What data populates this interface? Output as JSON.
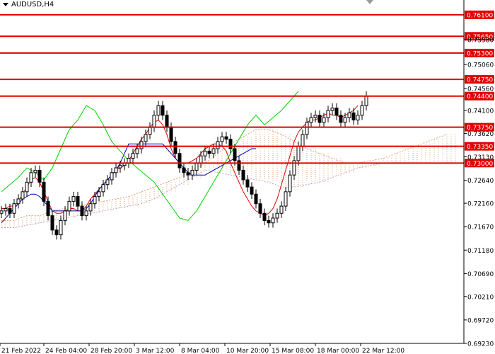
{
  "symbol": {
    "label": "AUDUSD,H4"
  },
  "chart_data": {
    "type": "candlestick",
    "symbol": "AUDUSD",
    "timeframe": "H4",
    "ylim": [
      0.6923,
      0.7635
    ],
    "x_tick_labels": [
      "21 Feb 2022",
      "24 Feb 04:00",
      "28 Feb 20:00",
      "3 Mar 12:00",
      "8 Mar 04:00",
      "10 Mar 20:00",
      "15 Mar 08:00",
      "18 Mar 00:00",
      "22 Mar 12:00"
    ],
    "y_tick_labels": [
      "0.75580",
      "0.75060",
      "0.74560",
      "0.74100",
      "0.73620",
      "0.73130",
      "0.72640",
      "0.72160",
      "0.71670",
      "0.71180",
      "0.70690",
      "0.70210",
      "0.69720",
      "0.69230"
    ],
    "y_tick_values": [
      0.7558,
      0.7506,
      0.7456,
      0.741,
      0.7362,
      0.7313,
      0.7264,
      0.7216,
      0.7167,
      0.7118,
      0.7069,
      0.7021,
      0.6972,
      0.6923
    ],
    "levels": [
      {
        "label": "0.76100",
        "value": 0.761
      },
      {
        "label": "0.75650",
        "value": 0.7565
      },
      {
        "label": "0.75300",
        "value": 0.753
      },
      {
        "label": "0.74750",
        "value": 0.7475
      },
      {
        "label": "0.74400",
        "value": 0.744
      },
      {
        "label": "0.73750",
        "value": 0.7375
      },
      {
        "label": "0.73350",
        "value": 0.7335
      },
      {
        "label": "0.73000",
        "value": 0.73
      }
    ],
    "close": [
      0.72,
      0.7205,
      0.7195,
      0.7215,
      0.7225,
      0.724,
      0.726,
      0.728,
      0.7285,
      0.726,
      0.722,
      0.719,
      0.716,
      0.715,
      0.718,
      0.72,
      0.722,
      0.723,
      0.721,
      0.719,
      0.72,
      0.7215,
      0.723,
      0.724,
      0.7255,
      0.7265,
      0.728,
      0.729,
      0.7295,
      0.73,
      0.731,
      0.732,
      0.733,
      0.7345,
      0.736,
      0.7375,
      0.74,
      0.742,
      0.74,
      0.7375,
      0.7345,
      0.732,
      0.729,
      0.728,
      0.7275,
      0.7285,
      0.73,
      0.7315,
      0.7325,
      0.732,
      0.733,
      0.7345,
      0.7355,
      0.735,
      0.733,
      0.7305,
      0.7285,
      0.7265,
      0.725,
      0.7235,
      0.7215,
      0.7195,
      0.718,
      0.7175,
      0.7185,
      0.7195,
      0.721,
      0.724,
      0.7275,
      0.7305,
      0.7335,
      0.736,
      0.7385,
      0.7395,
      0.74,
      0.7385,
      0.7395,
      0.741,
      0.7415,
      0.74,
      0.7385,
      0.7395,
      0.7405,
      0.739,
      0.74,
      0.742,
      0.744
    ],
    "indicators": [
      {
        "type": "tenkan-line",
        "color": "#e00000",
        "values": [
          0.7205,
          0.7205,
          0.721,
          0.721,
          0.722,
          0.7235,
          0.725,
          0.7265,
          0.727,
          0.726,
          0.724,
          0.722,
          0.72,
          0.7195,
          0.7195,
          0.72,
          0.7205,
          0.7205,
          0.72,
          0.72,
          0.721,
          0.7225,
          0.7235,
          0.7245,
          0.7255,
          0.7265,
          0.7275,
          0.7285,
          0.729,
          0.7295,
          0.7305,
          0.732,
          0.7335,
          0.735,
          0.736,
          0.7375,
          0.7385,
          0.739,
          0.738,
          0.736,
          0.733,
          0.731,
          0.73,
          0.73,
          0.73,
          0.7305,
          0.731,
          0.732,
          0.733,
          0.7335,
          0.734,
          0.734,
          0.7335,
          0.7325,
          0.73,
          0.728,
          0.726,
          0.724,
          0.7225,
          0.721,
          0.72,
          0.7195,
          0.719,
          0.7195,
          0.7205,
          0.7225,
          0.7255,
          0.7285,
          0.7315,
          0.7345,
          0.7365,
          0.7375,
          0.7385,
          0.739,
          0.739,
          0.7395,
          0.74,
          0.7405,
          0.74,
          0.74,
          0.7395,
          0.74,
          0.7405,
          0.741,
          0.742
        ]
      },
      {
        "type": "kijun-line",
        "color": "#0000b0",
        "values": [
          0.7175,
          0.7185,
          0.7195,
          0.7205,
          0.7215,
          0.7225,
          0.723,
          0.7235,
          0.7235,
          0.723,
          0.722,
          0.721,
          0.72,
          0.72,
          0.72,
          0.72,
          0.72,
          0.72,
          0.72,
          0.72,
          0.7205,
          0.7215,
          0.723,
          0.7245,
          0.7255,
          0.7265,
          0.7275,
          0.7285,
          0.73,
          0.732,
          0.734,
          0.734,
          0.734,
          0.734,
          0.734,
          0.734,
          0.734,
          0.734,
          0.734,
          0.733,
          0.732,
          0.731,
          0.73,
          0.729,
          0.728,
          0.7275,
          0.7275,
          0.7275,
          0.7275,
          0.728,
          0.7285,
          0.729,
          0.7295,
          0.73,
          0.7305,
          0.731,
          0.7315,
          0.732,
          0.7325,
          0.733,
          0.733
        ]
      },
      {
        "type": "chikou-line",
        "color": "#00d000",
        "values": [
          0.724,
          0.7255,
          0.727,
          0.729,
          0.728,
          0.7265,
          0.729,
          0.733,
          0.737,
          0.739,
          0.742,
          0.741,
          0.738,
          0.7345,
          0.7325,
          0.7305,
          0.729,
          0.7275,
          0.726,
          0.7235,
          0.721,
          0.7185,
          0.718,
          0.72,
          0.723,
          0.726,
          0.729,
          0.732,
          0.735,
          0.738,
          0.74,
          0.738,
          0.7395,
          0.741,
          0.743,
          0.745
        ]
      },
      {
        "type": "cloud",
        "color": "#d08050",
        "span_a": [
          0.718,
          0.718,
          0.719,
          0.719,
          0.72,
          0.7205,
          0.721,
          0.7215,
          0.722,
          0.7225,
          0.723,
          0.724,
          0.725,
          0.726,
          0.727,
          0.7285,
          0.73,
          0.732,
          0.734,
          0.7355,
          0.737,
          0.737,
          0.736,
          0.7345,
          0.733,
          0.732,
          0.731,
          0.73,
          0.73,
          0.7305,
          0.731,
          0.732,
          0.733,
          0.734,
          0.735,
          0.736
        ],
        "span_b": [
          0.7165,
          0.7165,
          0.717,
          0.7175,
          0.718,
          0.7185,
          0.719,
          0.7195,
          0.72,
          0.7205,
          0.721,
          0.7215,
          0.7225,
          0.724,
          0.7255,
          0.727,
          0.7285,
          0.728,
          0.7275,
          0.727,
          0.7265,
          0.726,
          0.725,
          0.725,
          0.7255,
          0.726,
          0.727,
          0.728,
          0.729,
          0.7295,
          0.73,
          0.73,
          0.73,
          0.73,
          0.73,
          0.73
        ]
      }
    ]
  }
}
